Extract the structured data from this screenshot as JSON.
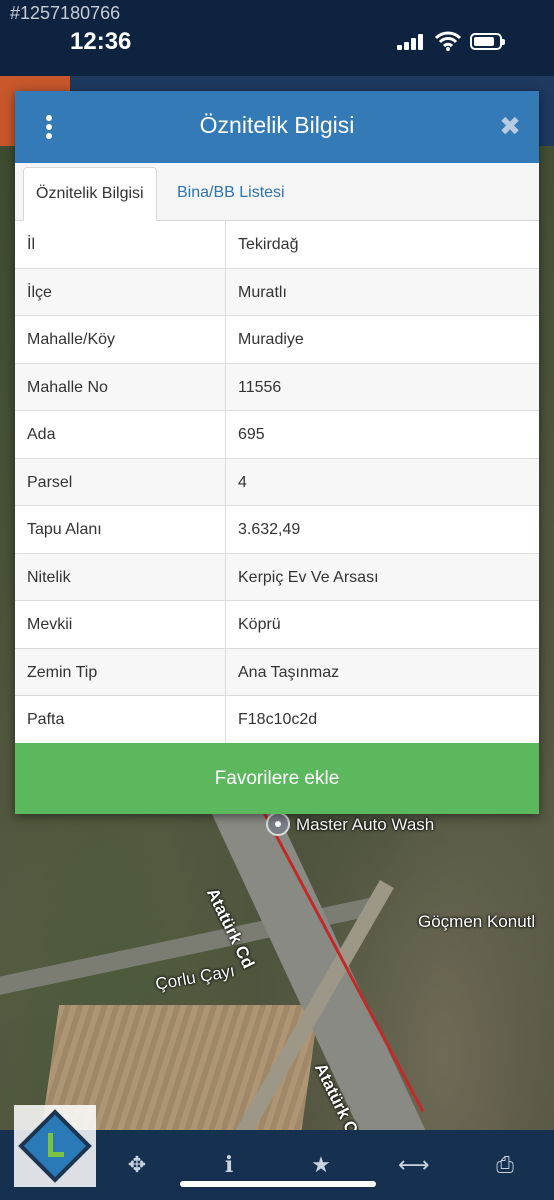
{
  "status_bar": {
    "watermark": "#1257180766",
    "time": "12:36"
  },
  "dialog": {
    "title": "Öznitelik Bilgisi",
    "tabs": [
      {
        "label": "Öznitelik Bilgisi",
        "active": true
      },
      {
        "label": "Bina/BB Listesi",
        "active": false
      }
    ],
    "rows": [
      {
        "key": "İl",
        "value": "Tekirdağ"
      },
      {
        "key": "İlçe",
        "value": "Muratlı"
      },
      {
        "key": "Mahalle/Köy",
        "value": "Muradiye"
      },
      {
        "key": "Mahalle No",
        "value": "11556"
      },
      {
        "key": "Ada",
        "value": "695"
      },
      {
        "key": "Parsel",
        "value": "4"
      },
      {
        "key": "Tapu Alanı",
        "value": "3.632,49"
      },
      {
        "key": "Nitelik",
        "value": "Kerpiç Ev Ve Arsası"
      },
      {
        "key": "Mevkii",
        "value": "Köprü"
      },
      {
        "key": "Zemin Tip",
        "value": "Ana Taşınmaz"
      },
      {
        "key": "Pafta",
        "value": "F18c10c2d"
      }
    ],
    "favorite_button": "Favorilere ekle"
  },
  "map": {
    "labels": [
      "Master Auto Wash",
      "Göçmen Konutl",
      "Çorlu Çayı",
      "Atatürk Cd",
      "Atatürk C"
    ]
  },
  "bottom_bar": {
    "icons": [
      "move-icon",
      "info-icon",
      "star-icon",
      "measure-icon",
      "print-icon"
    ]
  },
  "colors": {
    "header": "#337ab7",
    "favorite_button": "#5cb85c",
    "tab_link": "#2f74b0"
  }
}
